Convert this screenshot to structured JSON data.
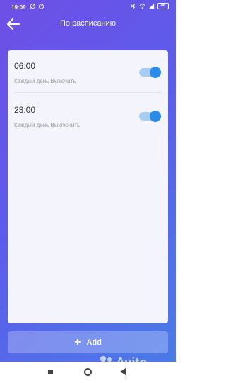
{
  "status_bar": {
    "time": "19:09",
    "battery": "46",
    "icons_left": [
      "alarm-off-icon",
      "alarm-icon"
    ],
    "icons_right": [
      "bluetooth-icon",
      "wifi-icon",
      "signal-icon",
      "battery-icon"
    ]
  },
  "header": {
    "title": "По расписанию",
    "back_icon": "arrow-left-icon"
  },
  "schedules": [
    {
      "time": "06:00",
      "description": "Каждый день Включить",
      "enabled": true
    },
    {
      "time": "23:00",
      "description": "Каждый день Выключить",
      "enabled": true
    }
  ],
  "add_button": {
    "label": "Add",
    "icon": "plus-icon"
  },
  "watermark": {
    "text": "Avito"
  },
  "nav_bar": {
    "icons": [
      "recents-icon",
      "home-icon",
      "back-icon"
    ]
  },
  "colors": {
    "gradient_start": "#6f4fe6",
    "gradient_end": "#4a7be8",
    "card": "#f4f5fc",
    "toggle_knob": "#2b8be8",
    "toggle_track": "#a7cdf2"
  }
}
